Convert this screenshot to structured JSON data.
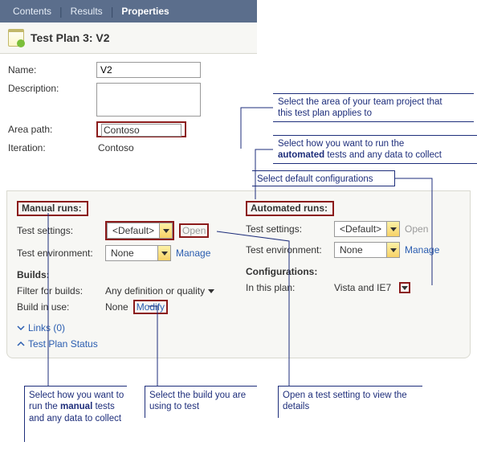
{
  "tabs": {
    "contents": "Contents",
    "results": "Results",
    "properties": "Properties"
  },
  "title": "Test Plan 3: V2",
  "form": {
    "name_label": "Name:",
    "name_value": "V2",
    "desc_label": "Description:",
    "area_label": "Area path:",
    "area_value": "Contoso",
    "iter_label": "Iteration:",
    "iter_value": "Contoso"
  },
  "manual": {
    "heading": "Manual runs:",
    "test_settings_label": "Test settings:",
    "test_settings_value": "<Default>",
    "open": "Open",
    "env_label": "Test environment:",
    "env_value": "None",
    "manage": "Manage"
  },
  "automated": {
    "heading": "Automated runs:",
    "test_settings_label": "Test settings:",
    "test_settings_value": "<Default>",
    "open": "Open",
    "env_label": "Test environment:",
    "env_value": "None",
    "manage": "Manage"
  },
  "builds": {
    "heading": "Builds:",
    "filter_label": "Filter for builds:",
    "filter_value": "Any definition or quality",
    "inuse_label": "Build in use:",
    "inuse_value": "None",
    "modify": "Modify"
  },
  "configs": {
    "heading": "Configurations:",
    "inplan_label": "In this plan:",
    "inplan_value": "Vista and IE7"
  },
  "links_exp": "Links (0)",
  "plan_status": "Test Plan Status",
  "callouts": {
    "area": "Select the area of your team project that this test plan applies to",
    "auto_pre": "Select how you want to run the ",
    "auto_kw": "automated",
    "auto_post": " tests and any data to collect",
    "default_cfg": "Select default configurations",
    "manual_pre": "Select how you want to run the ",
    "manual_kw": "manual",
    "manual_post": " tests and any data to collect",
    "build": "Select the build you are using to test",
    "open": "Open a test setting to view the details"
  }
}
